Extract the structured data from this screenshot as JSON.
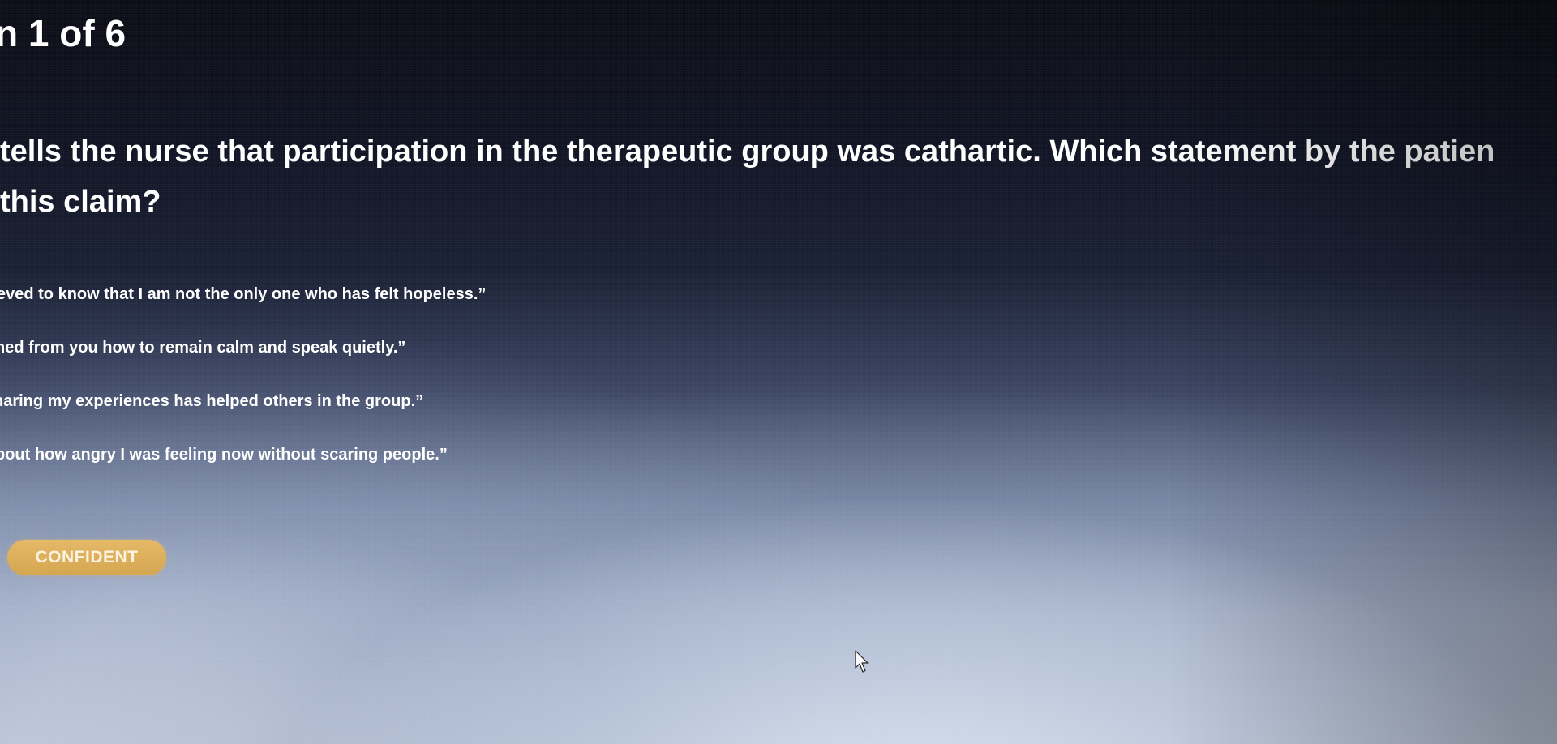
{
  "question": {
    "number_label": "n 1 of 6",
    "text_lines": [
      "tells the nurse that participation in the therapeutic group was cathartic. Which statement by the patien",
      "this claim?"
    ]
  },
  "options": [
    "eved to know that I am not the only one who has felt hopeless.”",
    "ned from you how to remain calm and speak quietly.”",
    "haring my experiences has helped others in the group.”",
    "bout how angry I was feeling now without scaring people.”"
  ],
  "buttons": {
    "confident_label": "CONFIDENT"
  },
  "colors": {
    "confident_button": "#dcae5a",
    "text": "#ffffff"
  },
  "icons": {
    "cursor": "mouse-pointer-icon"
  }
}
